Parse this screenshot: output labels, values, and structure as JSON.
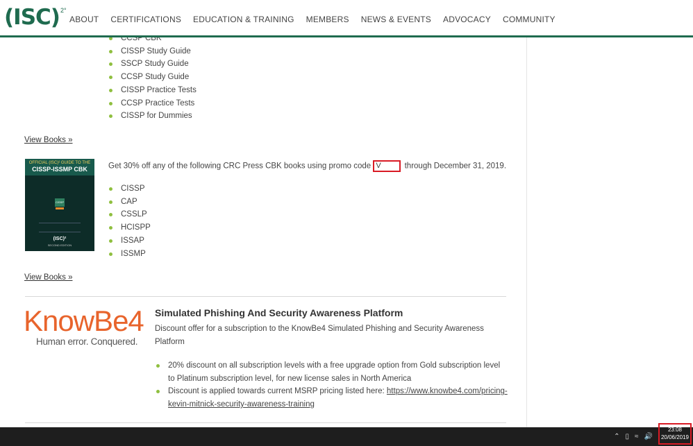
{
  "header": {
    "logo_text": "(ISC)",
    "logo_sup": "2°",
    "nav": [
      "ABOUT",
      "CERTIFICATIONS",
      "EDUCATION & TRAINING",
      "MEMBERS",
      "NEWS & EVENTS",
      "ADVOCACY",
      "COMMUNITY"
    ]
  },
  "books_list_1": [
    "CCSP CBK",
    "CISSP Study Guide",
    "SSCP Study Guide",
    "CCSP Study Guide",
    "CISSP Practice Tests",
    "CCSP Practice Tests",
    "CISSP for Dummies"
  ],
  "view_books_1": "View Books »",
  "crc": {
    "promo_before": "Get 30% off any of the following CRC Press CBK books using promo code",
    "promo_code": "V",
    "promo_after": "through December 31, 2019.",
    "items": [
      "CISSP",
      "CAP",
      "CSSLP",
      "HCISPP",
      "ISSAP",
      "ISSMP"
    ],
    "book_header": "OFFICIAL (ISC)² GUIDE TO THE",
    "book_title": "CISSP-ISSMP CBK",
    "book_badge": "CISSP",
    "book_publisher": "(ISC)²",
    "book_edition": "SECOND EDITION"
  },
  "view_books_2": "View Books »",
  "knowbe4": {
    "logo_main": "KnowBe4",
    "logo_tagline": "Human error. Conquered.",
    "title": "Simulated Phishing And Security Awareness Platform",
    "description": "Discount offer for a subscription to the KnowBe4 Simulated Phishing and Security Awareness Platform",
    "bullet_1": "20% discount on all subscription levels with a free upgrade option from Gold subscription level to Platinum subscription level, for new license sales in North America",
    "bullet_2_prefix": "Discount is applied towards current MSRP pricing listed here: ",
    "bullet_2_link": "https://www.knowbe4.com/pricing-kevin-mitnick-security-awareness-training"
  },
  "taskbar": {
    "time": "23:08",
    "date": "20/06/2019",
    "tray_icons": [
      "chevron-up-icon",
      "battery-icon",
      "wifi-icon",
      "volume-icon"
    ]
  }
}
